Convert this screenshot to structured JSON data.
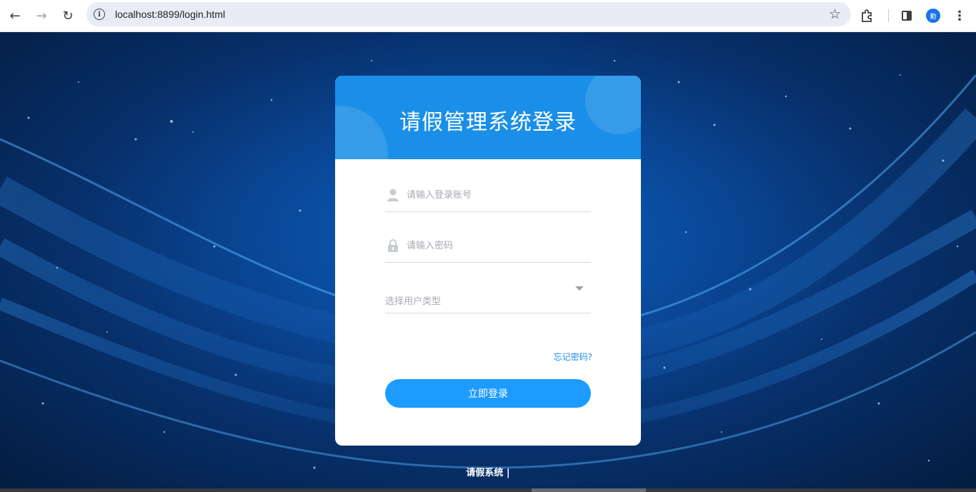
{
  "browser": {
    "url": "localhost:8899/login.html",
    "avatar_text": "勤"
  },
  "login": {
    "title": "请假管理系统登录",
    "username_placeholder": "请输入登录账号",
    "password_placeholder": "请输入密码",
    "user_type_placeholder": "选择用户类型",
    "forgot_password": "忘记密码?",
    "submit_label": "立即登录"
  },
  "footer": {
    "text": "请假系统 |"
  },
  "colors": {
    "header_blue": "#1b8fe8",
    "button_blue": "#1d9bff",
    "background_blue": "#0a4a9c"
  }
}
